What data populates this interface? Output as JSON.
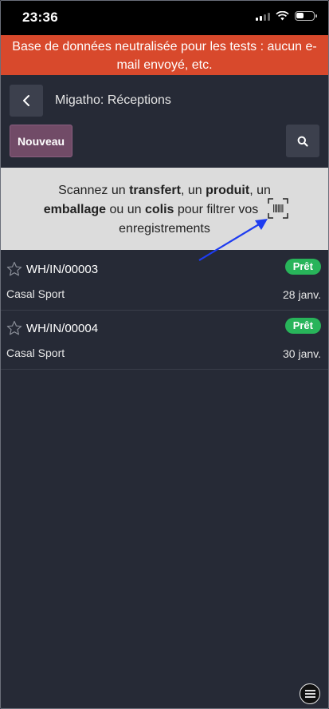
{
  "status_bar": {
    "time": "23:36"
  },
  "banner": {
    "text": "Base de données neutralisée pour les tests : aucun e-mail envoyé, etc."
  },
  "header": {
    "breadcrumb": "Migatho: Réceptions",
    "new_label": "Nouveau"
  },
  "scan_hint": {
    "p1": "Scannez un ",
    "b1": "transfert",
    "p2": ", un ",
    "b2": "produit",
    "p3": ", un",
    "b3": "emballage",
    "p4": " ou un ",
    "b4": "colis",
    "p5": " pour filtrer vos",
    "p6": "enregistrements"
  },
  "records": [
    {
      "reference": "WH/IN/00003",
      "status": "Prêt",
      "partner": "Casal Sport",
      "date": "28 janv."
    },
    {
      "reference": "WH/IN/00004",
      "status": "Prêt",
      "partner": "Casal Sport",
      "date": "30 janv."
    }
  ],
  "colors": {
    "accent": "#714b67",
    "banner": "#d8492c",
    "badge": "#28b45a",
    "arrow": "#1e3cf0"
  }
}
